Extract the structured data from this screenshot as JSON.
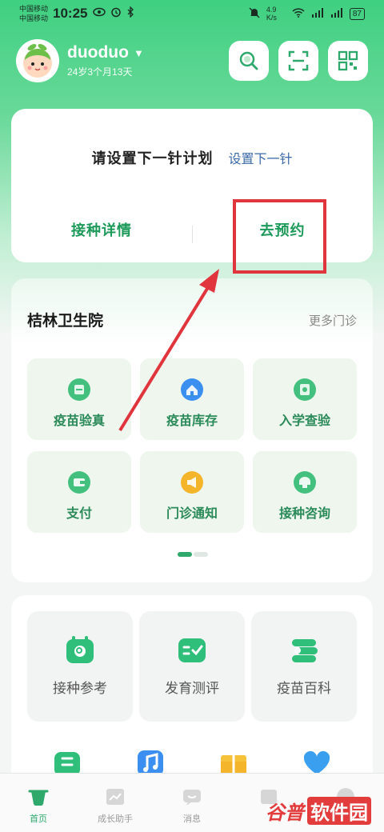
{
  "status_bar": {
    "carrier_1": "中国移动",
    "carrier_2": "中国移动",
    "time": "10:25",
    "speed": "4.9 K/s",
    "battery": "87"
  },
  "header": {
    "user_name": "duoduo",
    "user_age": "24岁3个月13天"
  },
  "plan": {
    "title": "请设置下一针计划",
    "link": "设置下一针",
    "action_left": "接种详情",
    "action_right": "去预约"
  },
  "clinic": {
    "name": "桔林卫生院",
    "more": "更多门诊",
    "services": [
      {
        "label": "疫苗验真"
      },
      {
        "label": "疫苗库存"
      },
      {
        "label": "入学查验"
      },
      {
        "label": "支付"
      },
      {
        "label": "门诊通知"
      },
      {
        "label": "接种咨询"
      }
    ]
  },
  "tools": [
    {
      "label": "接种参考"
    },
    {
      "label": "发育测评"
    },
    {
      "label": "疫苗百科"
    }
  ],
  "tabbar": [
    {
      "label": "首页"
    },
    {
      "label": "成长助手"
    },
    {
      "label": "消息"
    },
    {
      "label": ""
    },
    {
      "label": ""
    }
  ],
  "watermark": {
    "part1": "谷普",
    "part2": "软件园"
  },
  "colors": {
    "brand_green": "#2ea86b",
    "link_blue": "#3b6aa8",
    "annotation_red": "#e0353d"
  }
}
